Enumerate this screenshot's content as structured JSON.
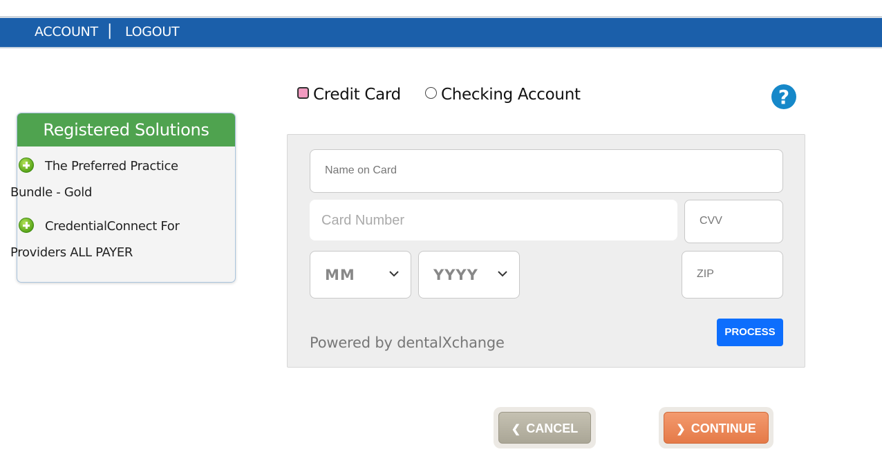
{
  "nav": {
    "account": "ACCOUNT",
    "separator": "|",
    "logout": "LOGOUT"
  },
  "sidebar": {
    "title": "Registered Solutions",
    "items": [
      {
        "line1": "The Preferred Practice",
        "line2": "Bundle - Gold",
        "icon": "plus-circle-icon"
      },
      {
        "line1": "CredentialConnect For",
        "line2": "Providers ALL PAYER",
        "icon": "plus-circle-icon"
      }
    ]
  },
  "payment": {
    "options": [
      {
        "label": "Credit Card",
        "selected": true
      },
      {
        "label": "Checking Account",
        "selected": false
      }
    ],
    "help": "?"
  },
  "form": {
    "name_placeholder": "Name on Card",
    "card_placeholder": "Card Number",
    "cvv_placeholder": "CVV",
    "month_value": "MM",
    "year_value": "YYYY",
    "zip_placeholder": "ZIP",
    "powered_by": "Powered by dentalXchange",
    "process_label": "PROCESS"
  },
  "actions": {
    "cancel": "CANCEL",
    "continue": "CONTINUE"
  },
  "colors": {
    "navbar": "#1b5faa",
    "sidebar_header": "#4fa34f",
    "process": "#0d6efd",
    "continue": "#e98050",
    "cancel": "#b8b4a4"
  }
}
